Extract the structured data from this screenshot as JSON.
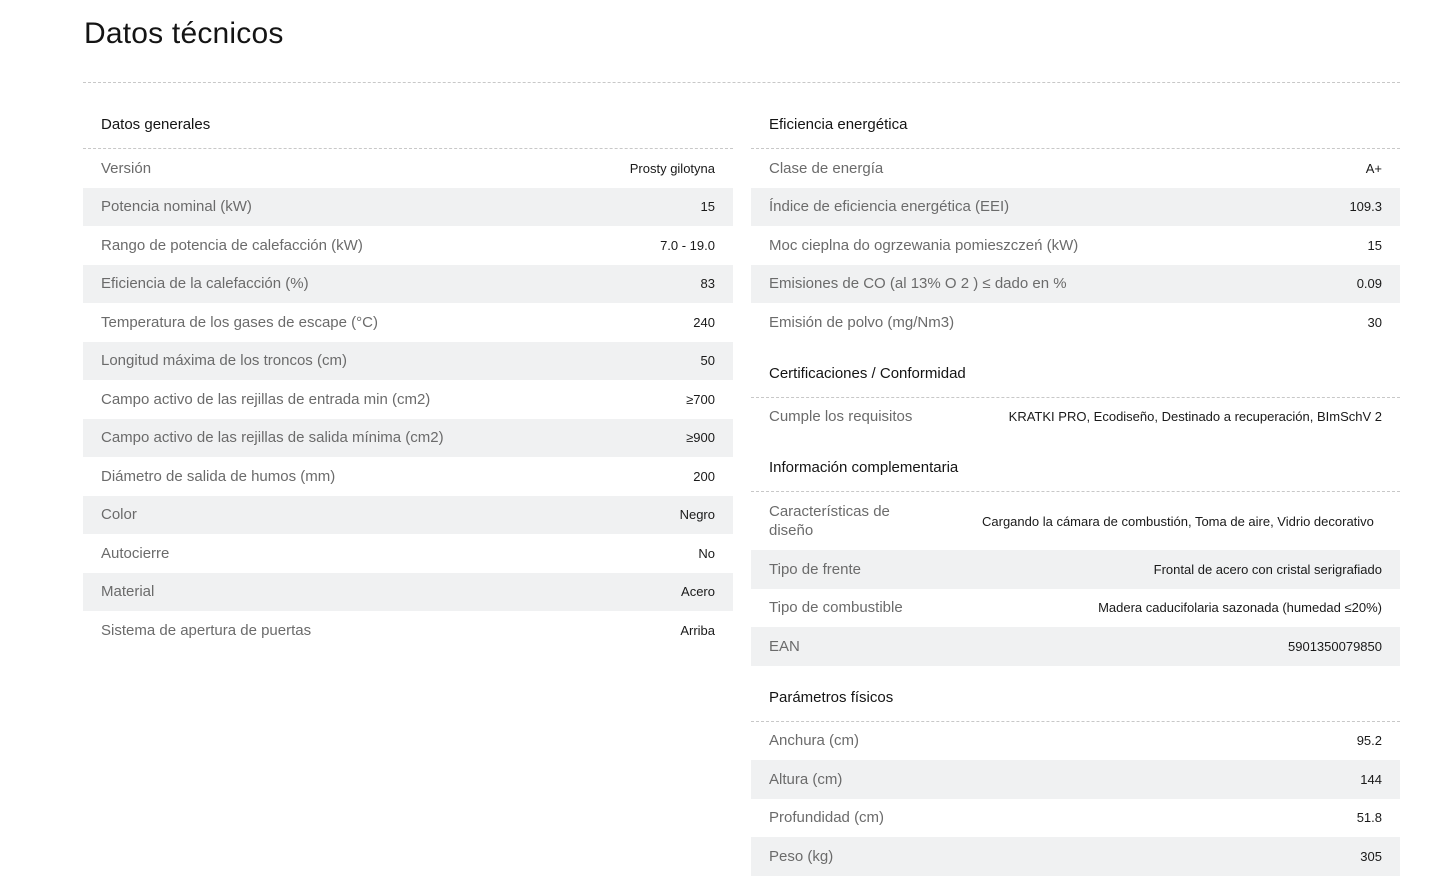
{
  "page": {
    "title": "Datos técnicos"
  },
  "general": {
    "heading": "Datos generales",
    "rows": [
      {
        "label": "Versión",
        "value": "Prosty gilotyna"
      },
      {
        "label": "Potencia nominal (kW)",
        "value": "15"
      },
      {
        "label": "Rango de potencia de calefacción (kW)",
        "value": "7.0 - 19.0"
      },
      {
        "label": "Eficiencia de la calefacción (%)",
        "value": "83"
      },
      {
        "label": "Temperatura de los gases de escape (°C)",
        "value": "240"
      },
      {
        "label": "Longitud máxima de los troncos (cm)",
        "value": "50"
      },
      {
        "label": "Campo activo de las rejillas de entrada min (cm2)",
        "value": "≥700"
      },
      {
        "label": "Campo activo de las rejillas de salida mínima (cm2)",
        "value": "≥900"
      },
      {
        "label": "Diámetro de salida de humos (mm)",
        "value": "200"
      },
      {
        "label": "Color",
        "value": "Negro"
      },
      {
        "label": "Autocierre",
        "value": "No"
      },
      {
        "label": "Material",
        "value": "Acero"
      },
      {
        "label": "Sistema de apertura de puertas",
        "value": "Arriba"
      }
    ]
  },
  "energy": {
    "heading": "Eficiencia energética",
    "rows": [
      {
        "label": "Clase de energía",
        "value": "A+"
      },
      {
        "label": "Índice de eficiencia energética (EEI)",
        "value": "109.3"
      },
      {
        "label": "Moc cieplna do ogrzewania pomieszczeń (kW)",
        "value": "15"
      },
      {
        "label": "Emisiones de CO (al 13% O 2 ) ≤ dado en %",
        "value": "0.09"
      },
      {
        "label": "Emisión de polvo (mg/Nm3)",
        "value": "30"
      }
    ]
  },
  "certs": {
    "heading": "Certificaciones / Conformidad",
    "rows": [
      {
        "label": "Cumple los requisitos",
        "value": "KRATKI PRO, Ecodiseño, Destinado a recuperación, BImSchV 2"
      }
    ]
  },
  "extra": {
    "heading": "Información complementaria",
    "rows": [
      {
        "label": "Características de diseño",
        "value": "Cargando la cámara de combustión, Toma de aire, Vidrio decorativo"
      },
      {
        "label": "Tipo de frente",
        "value": "Frontal de acero con cristal serigrafiado"
      },
      {
        "label": "Tipo de combustible",
        "value": "Madera caducifolaria sazonada (humedad ≤20%)"
      },
      {
        "label": "EAN",
        "value": "5901350079850"
      }
    ]
  },
  "physical": {
    "heading": "Parámetros físicos",
    "rows": [
      {
        "label": "Anchura (cm)",
        "value": "95.2"
      },
      {
        "label": "Altura (cm)",
        "value": "144"
      },
      {
        "label": "Profundidad (cm)",
        "value": "51.8"
      },
      {
        "label": "Peso (kg)",
        "value": "305"
      }
    ]
  }
}
